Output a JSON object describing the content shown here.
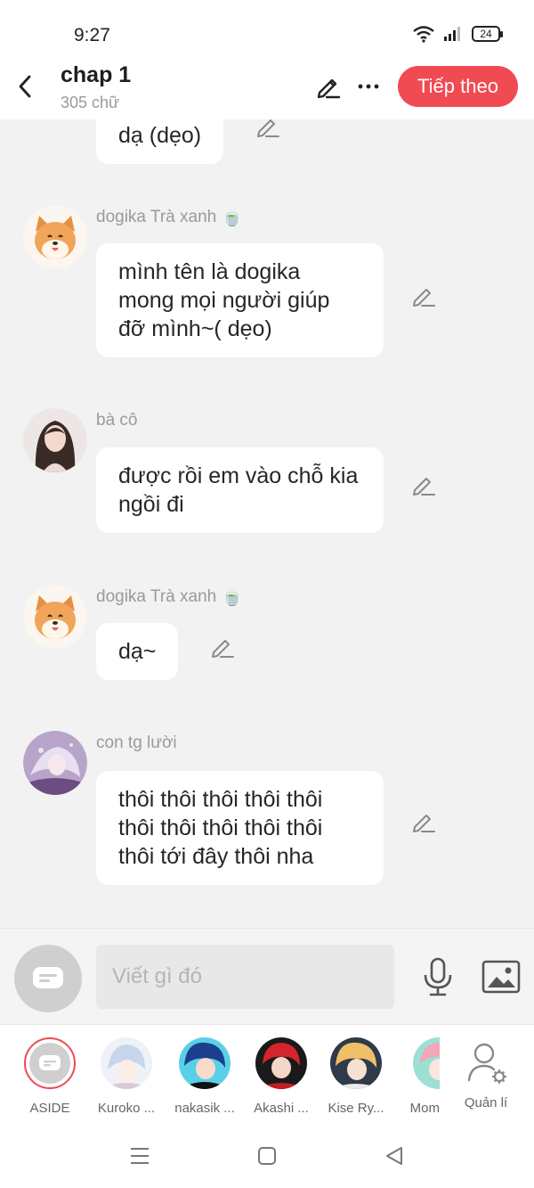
{
  "status_bar": {
    "time": "9:27",
    "battery": "24"
  },
  "header": {
    "title": "chap 1",
    "word_count": "305 chữ",
    "next_label": "Tiếp theo",
    "accent_color": "#f04a52"
  },
  "messages": [
    {
      "speaker": "",
      "text": "dạ (dẹo)"
    },
    {
      "speaker": "dogika Trà xanh",
      "speaker_emoji": "🍵",
      "text": "mình tên là dogika mong mọi người giúp đỡ mình~( dẹo)"
    },
    {
      "speaker": "bà cô",
      "text": "được rồi em vào chỗ kia ngồi đi"
    },
    {
      "speaker": "dogika Trà xanh",
      "speaker_emoji": "🍵",
      "text": "dạ~"
    },
    {
      "speaker": "con tg lười",
      "text": "thôi thôi thôi thôi thôi thôi thôi thôi thôi thôi thôi tới đây thôi nha"
    }
  ],
  "composer": {
    "placeholder": "Viết gì đó"
  },
  "characters": [
    {
      "label": "ASIDE"
    },
    {
      "label": "Kuroko ..."
    },
    {
      "label": "nakasik ..."
    },
    {
      "label": "Akashi ..."
    },
    {
      "label": "Kise Ry..."
    },
    {
      "label": "Mom"
    },
    {
      "label": "Quản lí"
    }
  ]
}
